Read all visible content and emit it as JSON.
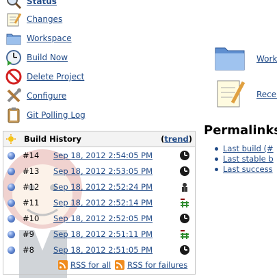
{
  "sidebar": {
    "items": [
      {
        "label": "Status",
        "icon": "magnifier-icon"
      },
      {
        "label": "Changes",
        "icon": "notepad-icon"
      },
      {
        "label": "Workspace",
        "icon": "folder-icon"
      },
      {
        "label": "Build Now",
        "icon": "clock-play-icon"
      },
      {
        "label": "Delete Project",
        "icon": "no-entry-icon"
      },
      {
        "label": "Configure",
        "icon": "tools-icon"
      },
      {
        "label": "Git Polling Log",
        "icon": "clipboard-icon"
      }
    ]
  },
  "build_history": {
    "title": "Build History",
    "trend_open": "(",
    "trend_label": "trend",
    "trend_close": ")",
    "builds": [
      {
        "number": "#14",
        "date": "Sep 18, 2012 2:54:05 PM",
        "cause": "timer-icon"
      },
      {
        "number": "#13",
        "date": "Sep 18, 2012 2:53:05 PM",
        "cause": "timer-icon"
      },
      {
        "number": "#12",
        "date": "Sep 18, 2012 2:52:24 PM",
        "cause": "user-icon"
      },
      {
        "number": "#11",
        "date": "Sep 18, 2012 2:52:14 PM",
        "cause": "scm-change-icon"
      },
      {
        "number": "#10",
        "date": "Sep 18, 2012 2:52:05 PM",
        "cause": "timer-icon"
      },
      {
        "number": "#9",
        "date": "Sep 18, 2012 2:51:11 PM",
        "cause": "scm-change-icon"
      },
      {
        "number": "#8",
        "date": "Sep 18, 2012 2:51:05 PM",
        "cause": "timer-icon"
      }
    ],
    "rss_all": "RSS for all",
    "rss_failures": "RSS for failures"
  },
  "main": {
    "links": [
      {
        "label": "Work",
        "icon": "folder-icon"
      },
      {
        "label": "Recen",
        "icon": "notepad-icon"
      }
    ],
    "permalinks_title": "Permalinks",
    "permalinks": [
      "Last build (#",
      "Last stable b",
      "Last success"
    ]
  },
  "colors": {
    "link": "#204a87",
    "build_ball": "#4d6fba",
    "rss": "#f08c1e"
  }
}
